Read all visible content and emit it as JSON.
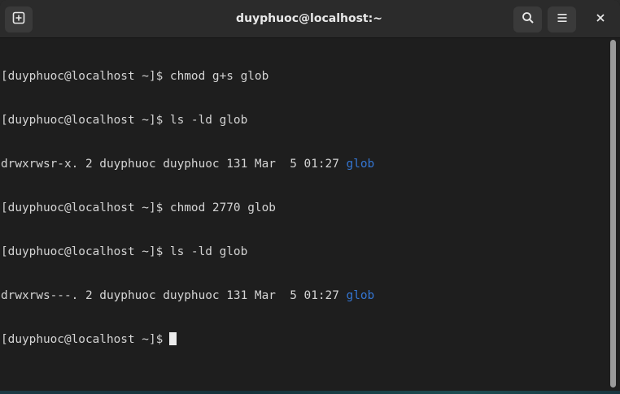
{
  "window": {
    "title": "duyphuoc@localhost:~"
  },
  "header": {
    "icons": {
      "new_tab": "new-tab-icon",
      "search": "search-icon",
      "menu": "hamburger-menu-icon",
      "close": "close-icon"
    }
  },
  "terminal": {
    "lines": [
      {
        "text": "[duyphuoc@localhost ~]$ chmod g+s glob"
      },
      {
        "text": "[duyphuoc@localhost ~]$ ls -ld glob"
      },
      {
        "text": "drwxrwsr-x. 2 duyphuoc duyphuoc 131 Mar  5 01:27 ",
        "highlight": "glob"
      },
      {
        "text": "[duyphuoc@localhost ~]$ chmod 2770 glob"
      },
      {
        "text": "[duyphuoc@localhost ~]$ ls -ld glob"
      },
      {
        "text": "drwxrws---. 2 duyphuoc duyphuoc 131 Mar  5 01:27 ",
        "highlight": "glob"
      },
      {
        "text": "[duyphuoc@localhost ~]$"
      }
    ]
  },
  "colors": {
    "background": "#1e1e1e",
    "text": "#d4d4d4",
    "directory": "#3476d3",
    "titlebar": "#2b2b2b"
  }
}
